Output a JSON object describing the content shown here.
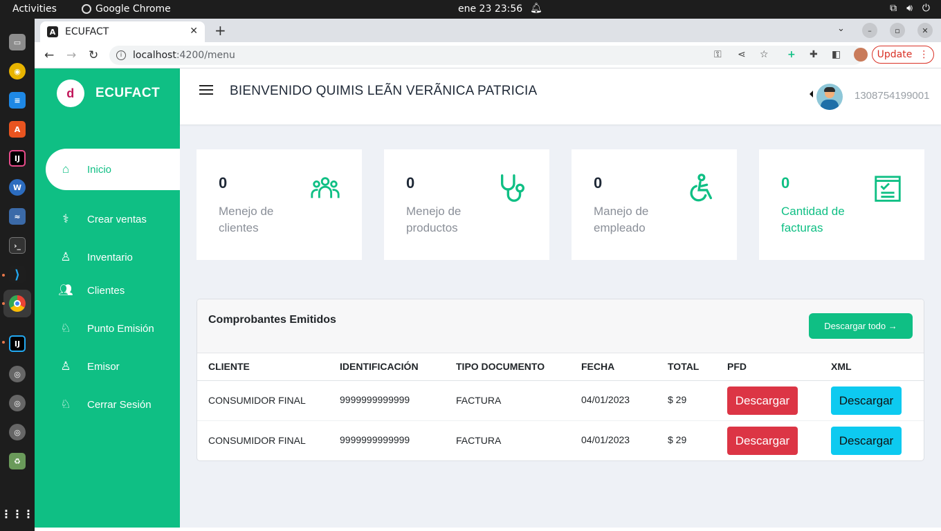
{
  "os": {
    "activities": "Activities",
    "app_name": "Google Chrome",
    "clock": "ene 23  23:56"
  },
  "browser": {
    "tab_title": "ECUFACT",
    "url_host": "localhost",
    "url_path": ":4200/menu",
    "update_label": "Update"
  },
  "sidebar": {
    "brand": "ECUFACT",
    "items": [
      {
        "label": "Inicio",
        "icon": "home-icon"
      },
      {
        "label": "Crear ventas",
        "icon": "stethoscope-icon"
      },
      {
        "label": "Inventario",
        "icon": "user-icon"
      },
      {
        "label": "Clientes",
        "icon": "users-icon"
      },
      {
        "label": "Punto Emisión",
        "icon": "user-tie-icon"
      },
      {
        "label": "Emisor",
        "icon": "user-icon"
      },
      {
        "label": "Cerrar Sesión",
        "icon": "user-tie-icon"
      }
    ]
  },
  "header": {
    "welcome": "BIENVENIDO QUIMIS LEÃN VERÃNICA PATRICIA",
    "user_id": "1308754199001"
  },
  "cards": [
    {
      "value": "0",
      "label": "Menejo de clientes",
      "icon": "group-icon"
    },
    {
      "value": "0",
      "label": "Menejo de productos",
      "icon": "stethoscope-icon"
    },
    {
      "value": "0",
      "label": "Manejo de empleado",
      "icon": "wheelchair-icon"
    },
    {
      "value": "0",
      "label": "Cantidad de facturas",
      "icon": "invoice-icon"
    }
  ],
  "table": {
    "title": "Comprobantes Emitidos",
    "download_all": "Descargar todo →",
    "columns": [
      "CLIENTE",
      "IDENTIFICACIÓN",
      "TIPO DOCUMENTO",
      "FECHA",
      "TOTAL",
      "PFD",
      "XML"
    ],
    "rows": [
      {
        "cliente": "CONSUMIDOR FINAL",
        "identificacion": "9999999999999",
        "tipo": "FACTURA",
        "fecha": "04/01/2023",
        "total": "$ 29",
        "pfd": "Descargar",
        "xml": "Descargar"
      },
      {
        "cliente": "CONSUMIDOR FINAL",
        "identificacion": "9999999999999",
        "tipo": "FACTURA",
        "fecha": "04/01/2023",
        "total": "$ 29",
        "pfd": "Descargar",
        "xml": "Descargar"
      }
    ]
  },
  "colors": {
    "primary": "#0fbf84",
    "danger": "#dc3545",
    "info": "#0dcaf0",
    "background": "#eef1f6"
  }
}
